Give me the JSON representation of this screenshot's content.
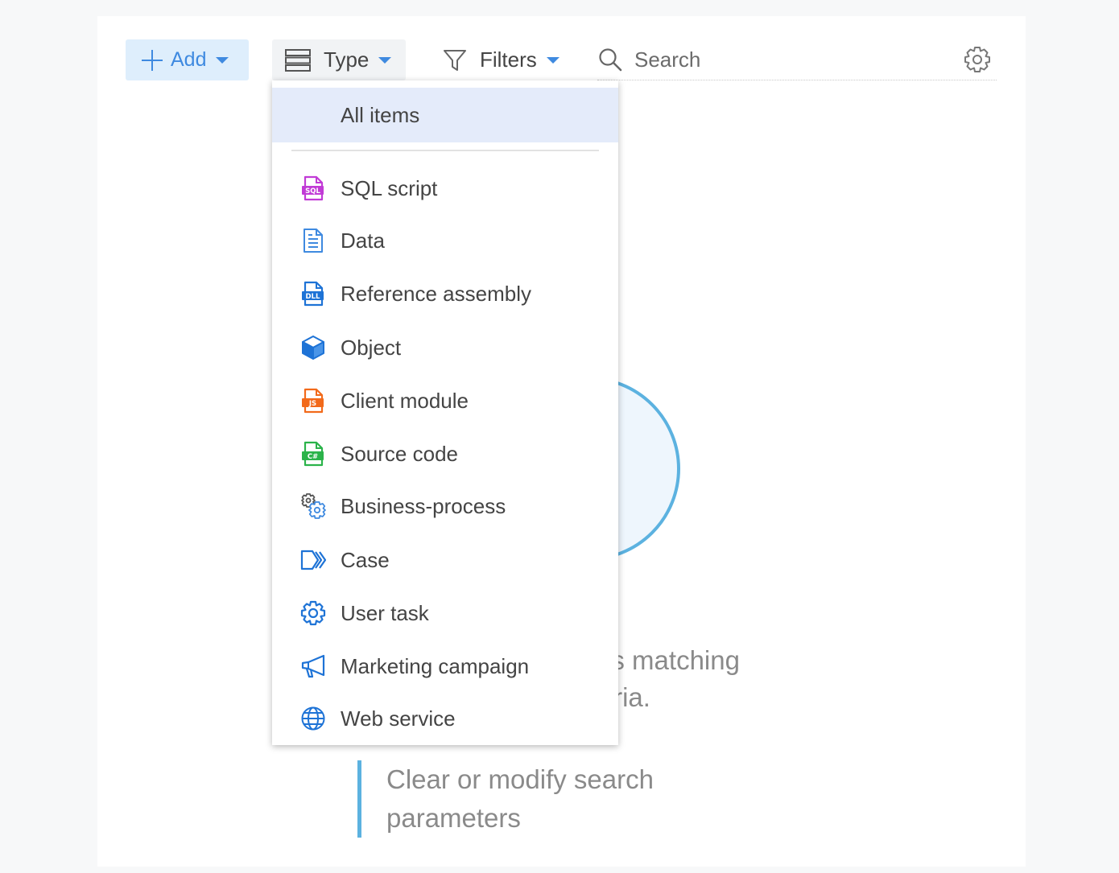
{
  "toolbar": {
    "add_label": "Add",
    "type_label": "Type",
    "filters_label": "Filters",
    "search_placeholder": "Search"
  },
  "empty_state": {
    "message_line1": "ds matching",
    "message_line2": "ria.",
    "hint_line1": "Clear or modify search",
    "hint_line2": "parameters"
  },
  "type_menu": {
    "all_items_label": "All items",
    "items": [
      {
        "label": "SQL script",
        "icon": "sql-file-icon",
        "color": "#c13bd6"
      },
      {
        "label": "Data",
        "icon": "data-file-icon",
        "color": "#3f8ae0"
      },
      {
        "label": "Reference assembly",
        "icon": "dll-file-icon",
        "color": "#1e73d6"
      },
      {
        "label": "Object",
        "icon": "cube-icon",
        "color": "#1e73d6"
      },
      {
        "label": "Client module",
        "icon": "js-file-icon",
        "color": "#f26a1b"
      },
      {
        "label": "Source code",
        "icon": "csharp-file-icon",
        "color": "#2bb34a"
      },
      {
        "label": "Business-process",
        "icon": "process-gears-icon",
        "color": "#3f8ae0"
      },
      {
        "label": "Case",
        "icon": "case-icon",
        "color": "#1e73d6"
      },
      {
        "label": "User task",
        "icon": "gear-icon",
        "color": "#1e73d6"
      },
      {
        "label": "Marketing campaign",
        "icon": "megaphone-icon",
        "color": "#1e73d6"
      },
      {
        "label": "Web service",
        "icon": "globe-icon",
        "color": "#1e73d6"
      }
    ]
  },
  "colors": {
    "accent": "#3f8ae0",
    "add_bg": "#deeefc",
    "selected_bg": "#e4ebfa",
    "empty_accent": "#5cb2e0"
  }
}
